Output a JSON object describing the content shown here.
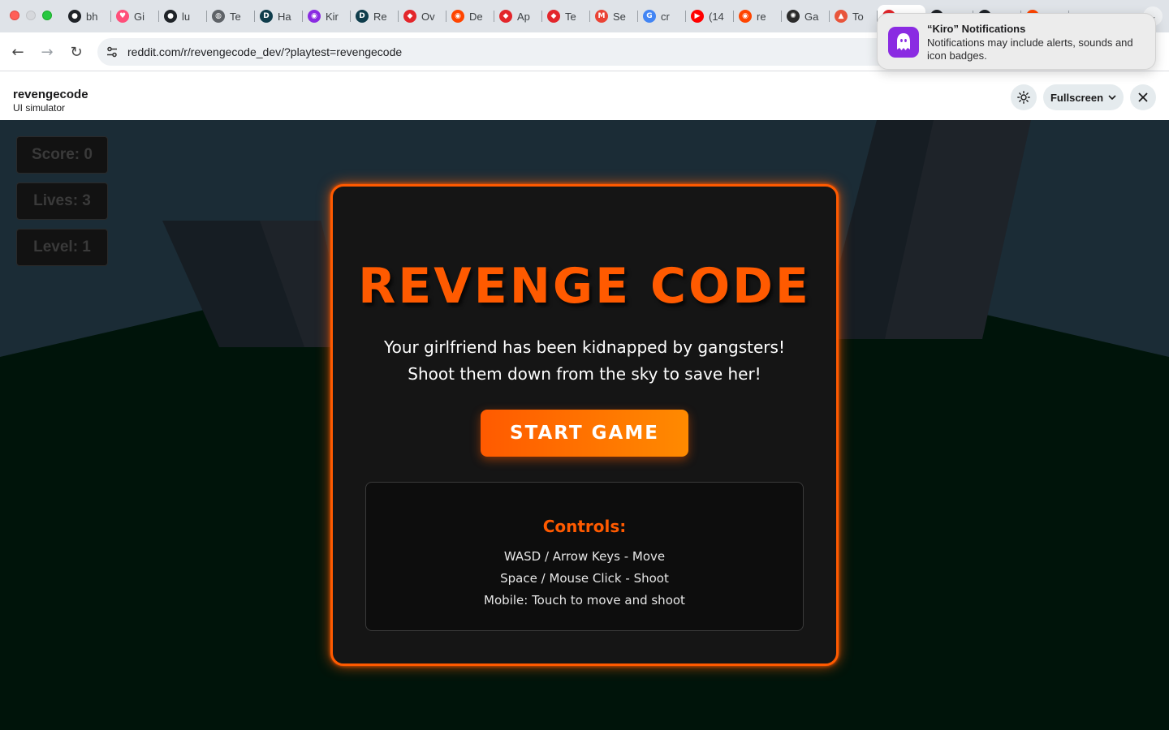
{
  "browser": {
    "tabs": [
      {
        "label": "bh",
        "icon": "github-icon",
        "color": "#1f2328",
        "glyph": "●"
      },
      {
        "label": "Gi",
        "icon": "heart-app-icon",
        "color": "#ff4f7a",
        "glyph": "♥"
      },
      {
        "label": "lu",
        "icon": "github-icon",
        "color": "#1f2328",
        "glyph": "●"
      },
      {
        "label": "Te",
        "icon": "globe-icon",
        "color": "#5f6368",
        "glyph": "◍"
      },
      {
        "label": "Ha",
        "icon": "d-logo-icon",
        "color": "#0f3d4c",
        "glyph": "D"
      },
      {
        "label": "Kir",
        "icon": "kiro-icon",
        "color": "#8a2be2",
        "glyph": "◉"
      },
      {
        "label": "Re",
        "icon": "d-logo-icon",
        "color": "#0f3d4c",
        "glyph": "D"
      },
      {
        "label": "Ov",
        "icon": "cube-icon",
        "color": "#e3262b",
        "glyph": "◆"
      },
      {
        "label": "De",
        "icon": "reddit-icon",
        "color": "#ff4500",
        "glyph": "◉"
      },
      {
        "label": "Ap",
        "icon": "cube-icon",
        "color": "#e3262b",
        "glyph": "◆"
      },
      {
        "label": "Te",
        "icon": "cube-icon",
        "color": "#e3262b",
        "glyph": "◆"
      },
      {
        "label": "Se",
        "icon": "gmail-icon",
        "color": "#ea4335",
        "glyph": "M"
      },
      {
        "label": "cr",
        "icon": "google-icon",
        "color": "#4285f4",
        "glyph": "G"
      },
      {
        "label": "(14",
        "icon": "youtube-icon",
        "color": "#ff0000",
        "glyph": "▶"
      },
      {
        "label": "re",
        "icon": "reddit-icon",
        "color": "#ff4500",
        "glyph": "◉"
      },
      {
        "label": "Ga",
        "icon": "openai-icon",
        "color": "#2b2b2b",
        "glyph": "✺"
      },
      {
        "label": "To",
        "icon": "triangle-icon",
        "color": "#e8553b",
        "glyph": "▲"
      },
      {
        "label": "",
        "icon": "red-circle-icon",
        "color": "#e3262b",
        "glyph": "●"
      },
      {
        "label": "",
        "icon": "github-icon",
        "color": "#1f2328",
        "glyph": "●"
      },
      {
        "label": "",
        "icon": "github-icon",
        "color": "#1f2328",
        "glyph": "●"
      },
      {
        "label": "",
        "icon": "reddit-icon",
        "color": "#ff4500",
        "glyph": "◉"
      }
    ],
    "url": "reddit.com/r/revengecode_dev/?playtest=revengecode"
  },
  "notification": {
    "title": "“Kiro” Notifications",
    "body": "Notifications may include alerts, sounds and icon badges."
  },
  "simulator": {
    "app_name": "revengecode",
    "app_subtitle": "UI simulator",
    "fullscreen_label": "Fullscreen"
  },
  "game": {
    "hud": {
      "score": "Score: 0",
      "lives": "Lives: 3",
      "level": "Level: 1"
    },
    "title": "REVENGE CODE",
    "story_line1": "Your girlfriend has been kidnapped by gangsters!",
    "story_line2": "Shoot them down from the sky to save her!",
    "start_label": "START GAME",
    "controls_title": "Controls:",
    "controls": [
      "WASD / Arrow Keys - Move",
      "Space / Mouse Click - Shoot",
      "Mobile: Touch to move and shoot"
    ],
    "colors": {
      "accent": "#ff5a00",
      "panel": "#151515",
      "sky": "#1b2c36",
      "ground": "#00140a"
    }
  }
}
